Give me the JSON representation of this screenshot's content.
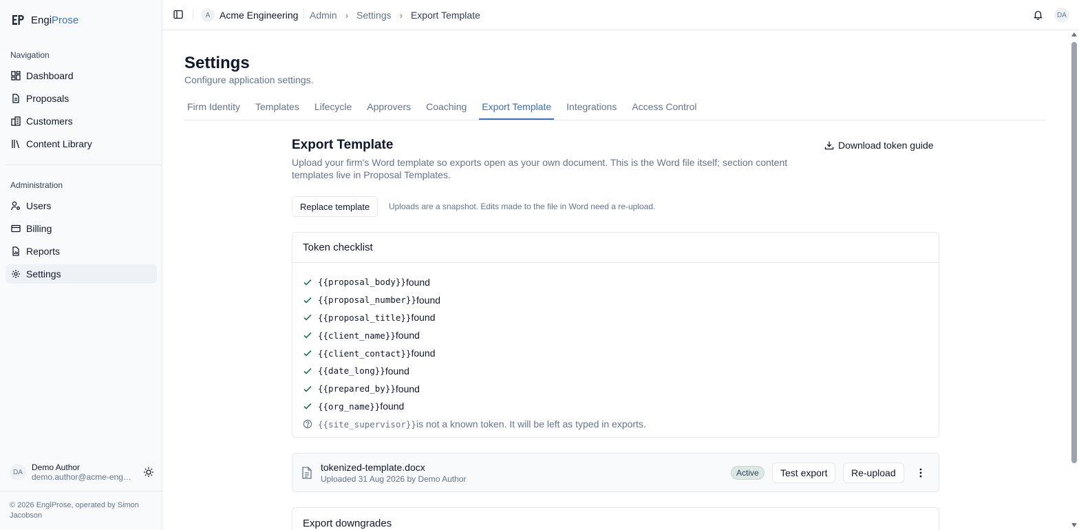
{
  "brand": {
    "name_prefix": "Engi",
    "name_suffix": "Prose",
    "brand_color": "#3b6fb5"
  },
  "sidebar": {
    "navigation_heading": "Navigation",
    "navigation_items": [
      {
        "label": "Dashboard",
        "icon": "dashboard-icon"
      },
      {
        "label": "Proposals",
        "icon": "document-icon"
      },
      {
        "label": "Customers",
        "icon": "building-icon"
      },
      {
        "label": "Content Library",
        "icon": "library-icon"
      }
    ],
    "administration_heading": "Administration",
    "administration_items": [
      {
        "label": "Users",
        "icon": "user-gear-icon"
      },
      {
        "label": "Billing",
        "icon": "card-icon"
      },
      {
        "label": "Reports",
        "icon": "report-icon"
      },
      {
        "label": "Settings",
        "icon": "gear-icon",
        "active": true
      }
    ],
    "user": {
      "initials": "DA",
      "name": "Demo Author",
      "email": "demo.author@acme-engi..."
    },
    "footer": "© 2026 EngiProse, operated by Simon Jacobson"
  },
  "topbar": {
    "org_initial": "A",
    "org_name": "Acme Engineering",
    "breadcrumbs": [
      "Admin",
      "Settings",
      "Export Template"
    ],
    "user_initials": "DA"
  },
  "page": {
    "title": "Settings",
    "subtitle": "Configure application settings.",
    "tabs": [
      "Firm Identity",
      "Templates",
      "Lifecycle",
      "Approvers",
      "Coaching",
      "Export Template",
      "Integrations",
      "Access Control"
    ],
    "active_tab": "Export Template"
  },
  "export_template": {
    "title": "Export Template",
    "description": "Upload your firm's Word template so exports open as your own document. This is the Word file itself; section content templates live in Proposal Templates.",
    "download_label": "Download token guide",
    "replace_label": "Replace template",
    "upload_note": "Uploads are a snapshot. Edits made to the file in Word need a re-upload.",
    "checklist_title": "Token checklist",
    "tokens": [
      {
        "token": "{{proposal_body}}",
        "status": " found"
      },
      {
        "token": "{{proposal_number}}",
        "status": " found"
      },
      {
        "token": "{{proposal_title}}",
        "status": " found"
      },
      {
        "token": "{{client_name}}",
        "status": " found"
      },
      {
        "token": "{{client_contact}}",
        "status": " found"
      },
      {
        "token": "{{date_long}}",
        "status": " found"
      },
      {
        "token": "{{prepared_by}}",
        "status": " found"
      },
      {
        "token": "{{org_name}}",
        "status": " found"
      }
    ],
    "unknown_token": {
      "token": "{{site_supervisor}}",
      "message": " is not a known token. It will be left as typed in exports."
    },
    "file": {
      "name": "tokenized-template.docx",
      "meta": "Uploaded 31 Aug 2026 by Demo Author",
      "badge": "Active",
      "test_label": "Test export",
      "reupload_label": "Re-upload"
    },
    "downgrades_title": "Export downgrades"
  },
  "colors": {
    "check": "#1f6f56",
    "accent": "#3b6fb5",
    "muted": "#64748b"
  }
}
